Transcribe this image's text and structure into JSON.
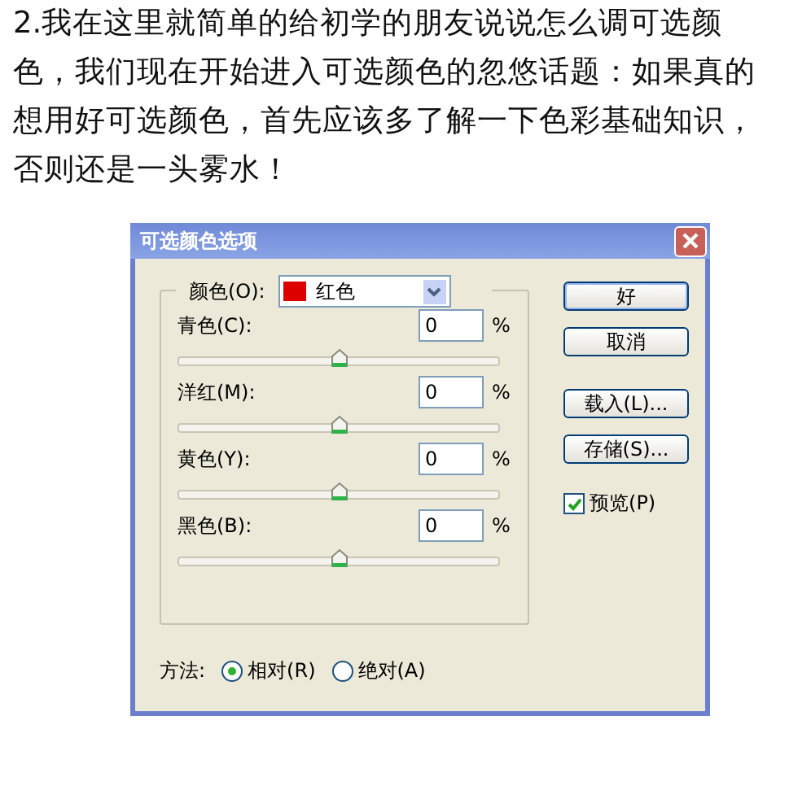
{
  "paragraph": "2.我在这里就简单的给初学的朋友说说怎么调可选颜色，我们现在开始进入可选颜色的忽悠话题：如果真的想用好可选颜色，首先应该多了解一下色彩基础知识，否则还是一头雾水！",
  "dialog": {
    "title": "可选颜色选项",
    "color_select": {
      "label": "颜色(O):",
      "value": "红色",
      "color": "#dd0000"
    },
    "sliders": [
      {
        "label": "青色(C):",
        "value": "0",
        "unit": "%",
        "level": 0.5
      },
      {
        "label": "洋红(M):",
        "value": "0",
        "unit": "%",
        "level": 0.5
      },
      {
        "label": "黄色(Y):",
        "value": "0",
        "unit": "%",
        "level": 0.5
      },
      {
        "label": "黑色(B):",
        "value": "0",
        "unit": "%",
        "level": 0.5
      }
    ],
    "buttons": [
      "好",
      "取消",
      "载入(L)...",
      "存储(S)..."
    ],
    "preview": {
      "label": "预览(P)",
      "checked": true
    },
    "method": {
      "label": "方法:",
      "options": [
        {
          "label": "相对(R)",
          "selected": true
        },
        {
          "label": "绝对(A)",
          "selected": false
        }
      ]
    }
  }
}
